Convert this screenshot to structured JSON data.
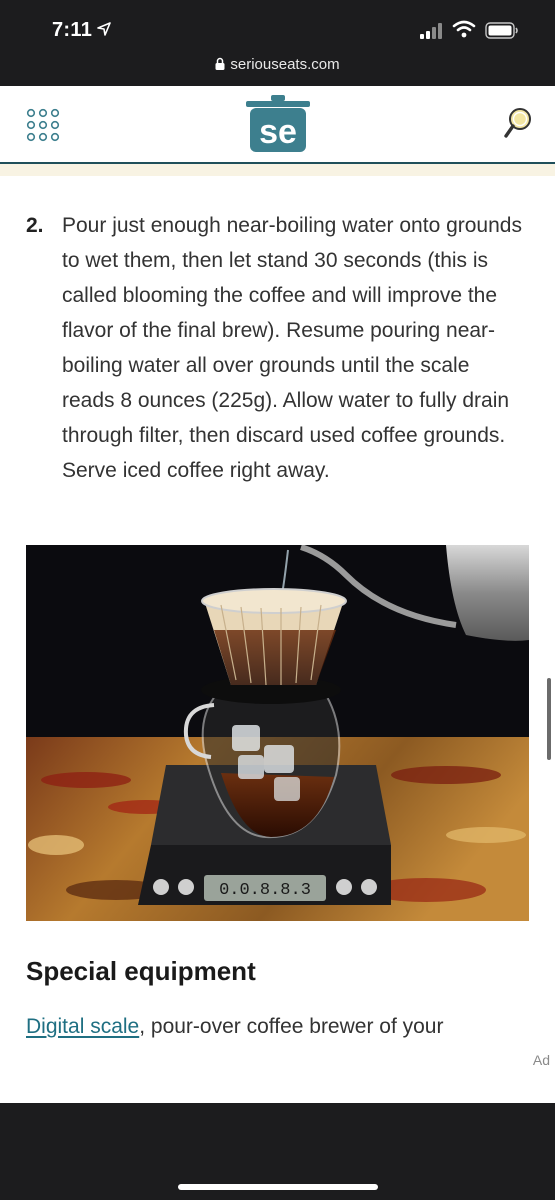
{
  "status_bar": {
    "time": "7:11",
    "url": "seriouseats.com"
  },
  "header": {
    "logo_text": "se",
    "brand_color": "#3d7f8e"
  },
  "article": {
    "step_number": "2.",
    "step_text": "Pour just enough near-boiling water onto grounds to wet them, then let stand 30 seconds (this is called blooming the coffee and will improve the flavor of the final brew). Resume pouring near-boiling water all over grounds until the scale reads 8 ounces (225g). Allow water to fully drain through filter, then discard used coffee grounds. Serve iced coffee right away.",
    "photo": {
      "scale_display": "0.0.8.8.3"
    },
    "section_heading": "Special equipment",
    "equipment_link": "Digital scale",
    "equipment_text": ", pour-over coffee brewer of your",
    "ad_label": "Ad"
  },
  "icons": [
    "location-arrow-icon",
    "signal-icon",
    "wifi-icon",
    "battery-icon",
    "lock-icon",
    "menu-grid-icon",
    "search-icon"
  ]
}
